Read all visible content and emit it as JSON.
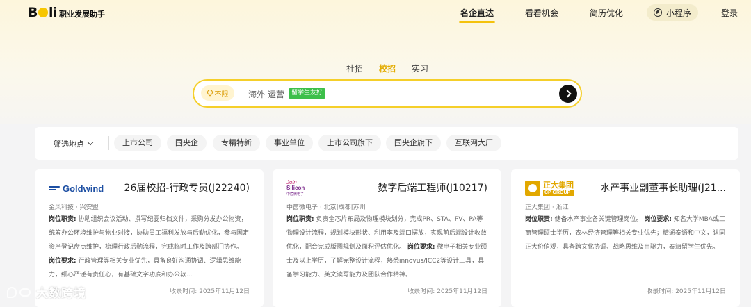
{
  "header": {
    "logo": {
      "brand": "Boli",
      "subtitle": "职业发展助手"
    },
    "nav": [
      {
        "label": "名企直达",
        "active": true
      },
      {
        "label": "看看机会",
        "active": false
      },
      {
        "label": "简历优化",
        "active": false
      }
    ],
    "mini_program": {
      "label": "小程序",
      "icon": "compass-icon"
    },
    "login": "登录"
  },
  "search_tabs": [
    {
      "label": "社招",
      "active": false
    },
    {
      "label": "校招",
      "active": true
    },
    {
      "label": "实习",
      "active": false
    }
  ],
  "search": {
    "location": "不限",
    "query": "海外 运营",
    "tag": "留学生友好"
  },
  "filters": {
    "location_label": "筛选地点",
    "chips": [
      "上市公司",
      "国央企",
      "专精特新",
      "事业单位",
      "上市公司旗下",
      "国央企旗下",
      "互联网大厂"
    ]
  },
  "jobs": [
    {
      "logo_text": "Goldwind",
      "title": "26届校招-行政专员(J22240)",
      "company": "金风科技 · 兴安盟",
      "duty_label": "岗位职责:",
      "duty": "协助组织会议活动、撰写纪要归档文件，采购分发办公物资，统筹办公环境维护与物业对接，协助员工福利发放与后勤优化，参与固定资产登记盘点维护，梳理行政后勤流程，完成临时工作及跨部门协作。",
      "req_label": "岗位要求:",
      "req": "行政管理等相关专业优先，具备良好沟通协调、逻辑思维能力，细心严谨有责任心，有基础文字功底和办公软...",
      "date": "收录时间: 2025年11月12日"
    },
    {
      "logo_text": "Join Silicon 中茵微电子",
      "title": "数字后端工程师(J10217)",
      "company": "中茵微电子 · 北京|成都|苏州",
      "duty_label": "岗位职责:",
      "duty": "负责全芯片布局及物理模块划分，完成PR、STA、PV、PA等物理设计流程，规划模块形状、利用率及端口摆放，实现前后端设计收敛优化，配合完成版图规划及面积评估优化。",
      "req_label": "岗位要求:",
      "req": "微电子相关专业硕士及以上学历，了解完整设计流程，熟悉innovus/ICC2等设计工具，具备学习能力、英文读写能力及团队合作精神。",
      "date": "收录时间: 2025年11月12日"
    },
    {
      "logo_text": "正大集团 CP GROUP",
      "title": "水产事业副董事长助理(J21...",
      "company": "正大集团 · 浙江",
      "duty_label": "岗位职责:",
      "duty": "储备水产事业各关键管理岗位。",
      "req_label": "岗位要求:",
      "req": "知名大学MBA或工商管理硕士学历，农林经济管理等相关专业优先；精通泰语和中文，认同正大价值观，具备跨文化协调、战略思维及自驱力，泰籍留学生优先。",
      "date": "收录时间: 2025年11月12日"
    }
  ],
  "watermark": "大数跨境",
  "colors": {
    "accent": "#f4c20d",
    "active_tab": "#e3ac00",
    "tag_green": "#3cbf4a"
  }
}
